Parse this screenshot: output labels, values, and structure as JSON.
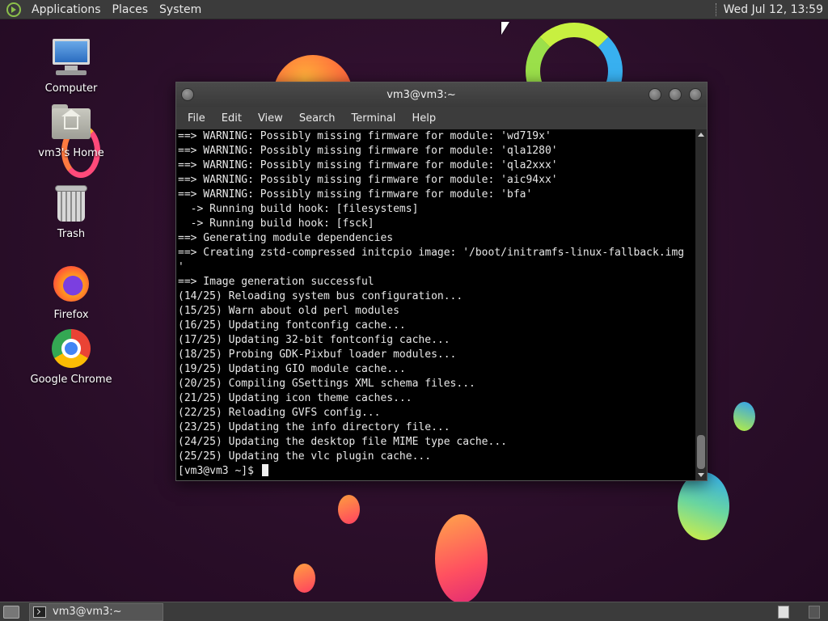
{
  "top_panel": {
    "menus": [
      "Applications",
      "Places",
      "System"
    ],
    "clock": "Wed Jul 12, 13:59"
  },
  "desktop_icons": {
    "computer": "Computer",
    "home": "vm3's Home",
    "trash": "Trash",
    "firefox": "Firefox",
    "chrome": "Google Chrome"
  },
  "terminal": {
    "title": "vm3@vm3:~",
    "menu": [
      "File",
      "Edit",
      "View",
      "Search",
      "Terminal",
      "Help"
    ],
    "lines": [
      "==> WARNING: Possibly missing firmware for module: 'wd719x'",
      "==> WARNING: Possibly missing firmware for module: 'qla1280'",
      "==> WARNING: Possibly missing firmware for module: 'qla2xxx'",
      "==> WARNING: Possibly missing firmware for module: 'aic94xx'",
      "==> WARNING: Possibly missing firmware for module: 'bfa'",
      "  -> Running build hook: [filesystems]",
      "  -> Running build hook: [fsck]",
      "==> Generating module dependencies",
      "==> Creating zstd-compressed initcpio image: '/boot/initramfs-linux-fallback.img",
      "'",
      "==> Image generation successful",
      "(14/25) Reloading system bus configuration...",
      "(15/25) Warn about old perl modules",
      "(16/25) Updating fontconfig cache...",
      "(17/25) Updating 32-bit fontconfig cache...",
      "(18/25) Probing GDK-Pixbuf loader modules...",
      "(19/25) Updating GIO module cache...",
      "(20/25) Compiling GSettings XML schema files...",
      "(21/25) Updating icon theme caches...",
      "(22/25) Reloading GVFS config...",
      "(23/25) Updating the info directory file...",
      "(24/25) Updating the desktop file MIME type cache...",
      "(25/25) Updating the vlc plugin cache..."
    ],
    "prompt": "[vm3@vm3 ~]$ "
  },
  "bottom_panel": {
    "task_label": "vm3@vm3:~"
  },
  "colors": {
    "panel_bg": "#3b3b3b",
    "terminal_bg": "#000000",
    "terminal_fg": "#e8e8e8"
  }
}
